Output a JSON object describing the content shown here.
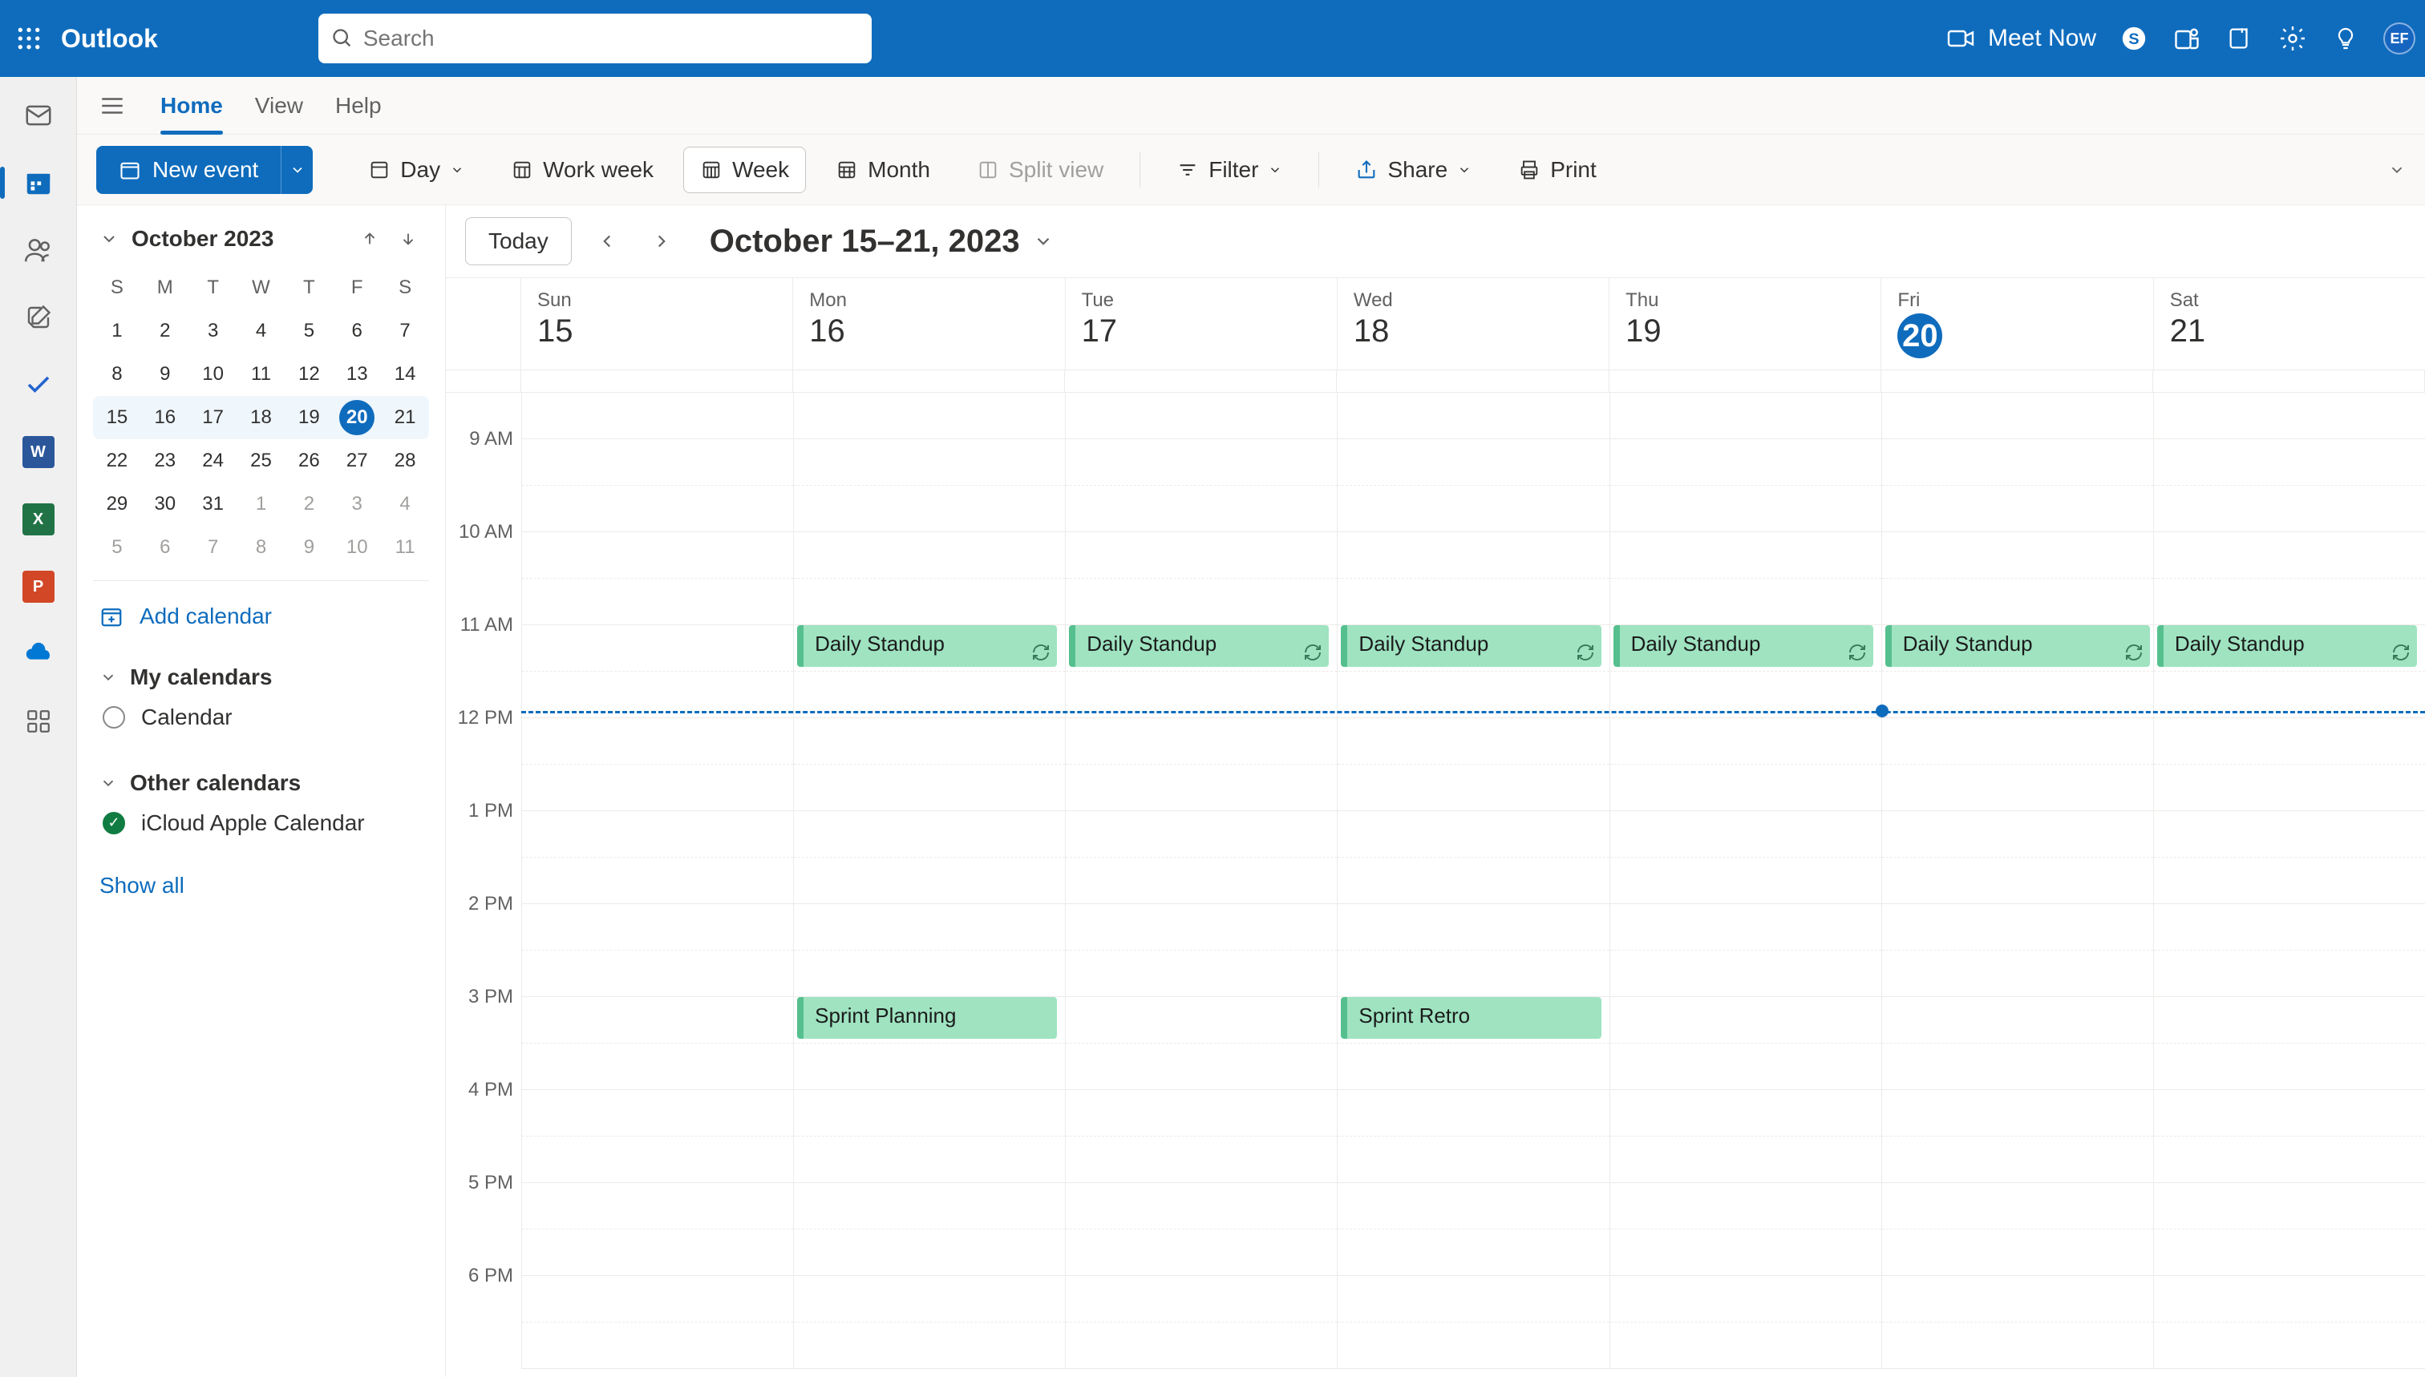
{
  "brand": "Outlook",
  "search_placeholder": "Search",
  "meet_now": "Meet Now",
  "avatar_initials": "EF",
  "tabs": {
    "home": "Home",
    "view": "View",
    "help": "Help"
  },
  "toolbar": {
    "new_event": "New event",
    "day": "Day",
    "work_week": "Work week",
    "week": "Week",
    "month": "Month",
    "split_view": "Split view",
    "filter": "Filter",
    "share": "Share",
    "print": "Print"
  },
  "mini_cal": {
    "title": "October 2023",
    "dow": [
      "S",
      "M",
      "T",
      "W",
      "T",
      "F",
      "S"
    ],
    "rows": [
      [
        "1",
        "2",
        "3",
        "4",
        "5",
        "6",
        "7"
      ],
      [
        "8",
        "9",
        "10",
        "11",
        "12",
        "13",
        "14"
      ],
      [
        "15",
        "16",
        "17",
        "18",
        "19",
        "20",
        "21"
      ],
      [
        "22",
        "23",
        "24",
        "25",
        "26",
        "27",
        "28"
      ],
      [
        "29",
        "30",
        "31",
        "1",
        "2",
        "3",
        "4"
      ],
      [
        "5",
        "6",
        "7",
        "8",
        "9",
        "10",
        "11"
      ]
    ]
  },
  "add_calendar": "Add calendar",
  "my_calendars": "My calendars",
  "calendar_item": "Calendar",
  "other_calendars": "Other calendars",
  "icloud_item": "iCloud Apple Calendar",
  "show_all": "Show all",
  "cal_nav": {
    "today": "Today",
    "range": "October 15–21, 2023"
  },
  "day_headers": [
    {
      "abbr": "Sun",
      "num": "15",
      "today": false
    },
    {
      "abbr": "Mon",
      "num": "16",
      "today": false
    },
    {
      "abbr": "Tue",
      "num": "17",
      "today": false
    },
    {
      "abbr": "Wed",
      "num": "18",
      "today": false
    },
    {
      "abbr": "Thu",
      "num": "19",
      "today": false
    },
    {
      "abbr": "Fri",
      "num": "20",
      "today": true
    },
    {
      "abbr": "Sat",
      "num": "21",
      "today": false
    }
  ],
  "time_labels": [
    "9 AM",
    "10 AM",
    "11 AM",
    "12 PM",
    "1 PM",
    "2 PM",
    "3 PM",
    "4 PM",
    "5 PM",
    "6 PM"
  ],
  "events": {
    "standup": "Daily Standup",
    "sprint_planning": "Sprint Planning",
    "sprint_retro": "Sprint Retro"
  }
}
